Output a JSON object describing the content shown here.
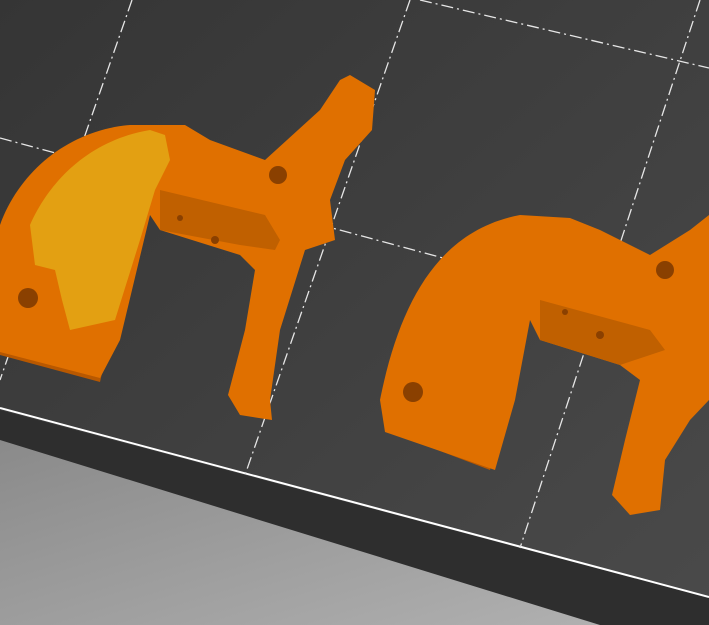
{
  "viewport": {
    "bed_color": "#3f3f3f",
    "bed_edge_color": "#ffffff",
    "floor_color": "#9a9a9a",
    "grid_color": "#e6e6e6"
  },
  "objects": [
    {
      "id": "part-left",
      "color": "#e07000",
      "shade": "#b85800",
      "selected_face_color": "#e3a012"
    },
    {
      "id": "part-right",
      "color": "#e07000",
      "shade": "#b85800"
    }
  ]
}
